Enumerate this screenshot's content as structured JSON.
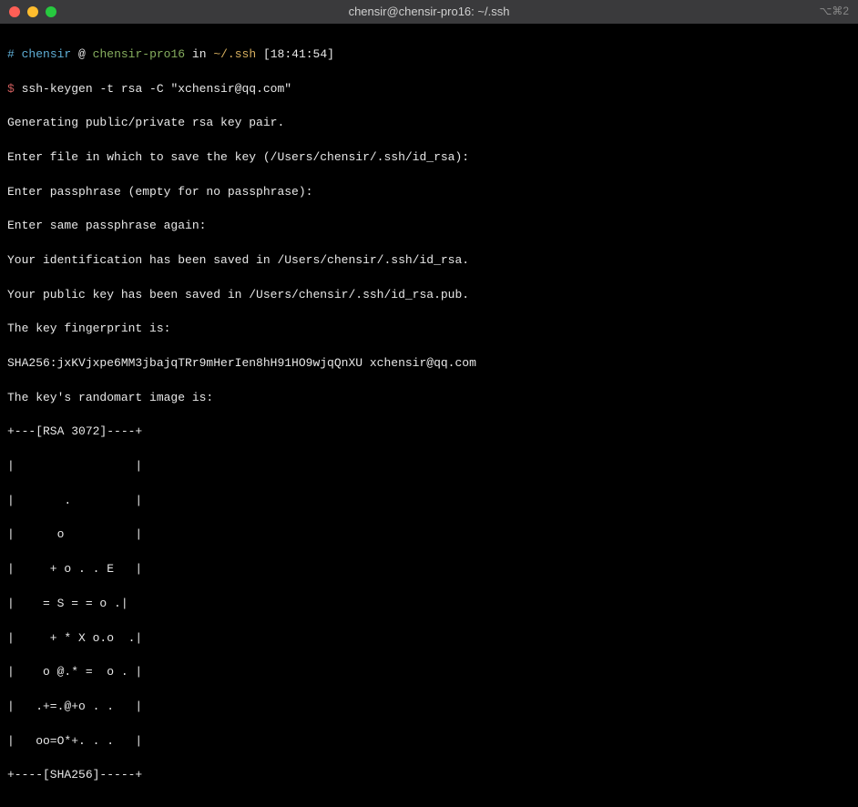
{
  "titlebar": {
    "title": "chensir@chensir-pro16: ~/.ssh",
    "right_glyph": "⌥⌘2"
  },
  "prompt": {
    "hash": "#",
    "user": "chensir",
    "at": "@",
    "host": "chensir-pro16",
    "in_literal": "in",
    "path": "~/.ssh",
    "time": "[18:41:54]"
  },
  "command": {
    "symbol": "$",
    "text": "ssh-keygen -t rsa -C \"xchensir@qq.com\""
  },
  "output": {
    "line1": "Generating public/private rsa key pair.",
    "line2": "Enter file in which to save the key (/Users/chensir/.ssh/id_rsa):",
    "line3": "Enter passphrase (empty for no passphrase):",
    "line4": "Enter same passphrase again:",
    "line5": "Your identification has been saved in /Users/chensir/.ssh/id_rsa.",
    "line6": "Your public key has been saved in /Users/chensir/.ssh/id_rsa.pub.",
    "line7": "The key fingerprint is:",
    "line8": "SHA256:jxKVjxpe6MM3jbajqTRr9mHerIen8hH91HO9wjqQnXU xchensir@qq.com",
    "line9": "The key's randomart image is:",
    "art01": "+---[RSA 3072]----+",
    "art02": "|                 |",
    "art03": "|       .         |",
    "art04": "|      o          |",
    "art05": "|     + o . . E   |",
    "art06": "|    = S = = o .|",
    "art07": "|     + * X o.o  .|",
    "art08": "|    o @.* =  o . |",
    "art09": "|   .+=.@+o . .   |",
    "art10": "|   oo=O*+. . .   |",
    "art11": "+----[SHA256]-----+"
  }
}
